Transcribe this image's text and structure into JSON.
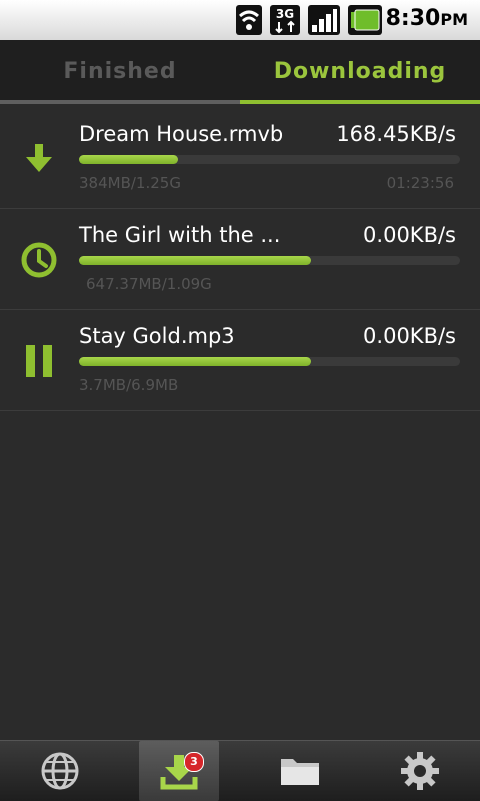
{
  "status_bar": {
    "time": "8:30",
    "ampm": "PM",
    "network_label": "3G",
    "icons": [
      "wifi-icon",
      "3g-data-icon",
      "signal-icon",
      "battery-icon"
    ]
  },
  "tabs": [
    {
      "label": "Finished",
      "active": false
    },
    {
      "label": "Downloading",
      "active": true
    }
  ],
  "downloads": [
    {
      "name": "Dream House.rmvb",
      "speed": "168.45KB/s",
      "progress": 0.26,
      "size": "384MB/1.25G",
      "eta": "01:23:56",
      "state_icon": "download-arrow-icon"
    },
    {
      "name": "The Girl with the ...",
      "speed": "0.00KB/s",
      "progress": 0.61,
      "size": "647.37MB/1.09G",
      "eta": "",
      "state_icon": "clock-icon"
    },
    {
      "name": "Stay Gold.mp3",
      "speed": "0.00KB/s",
      "progress": 0.61,
      "size": "3.7MB/6.9MB",
      "eta": "",
      "state_icon": "pause-icon"
    }
  ],
  "bottom_nav": {
    "items": [
      "globe-icon",
      "download-icon",
      "folder-icon",
      "gear-icon"
    ],
    "active_index": 1,
    "download_badge": "3"
  },
  "colors": {
    "accent": "#9bc53d",
    "background": "#2b2b2b"
  }
}
